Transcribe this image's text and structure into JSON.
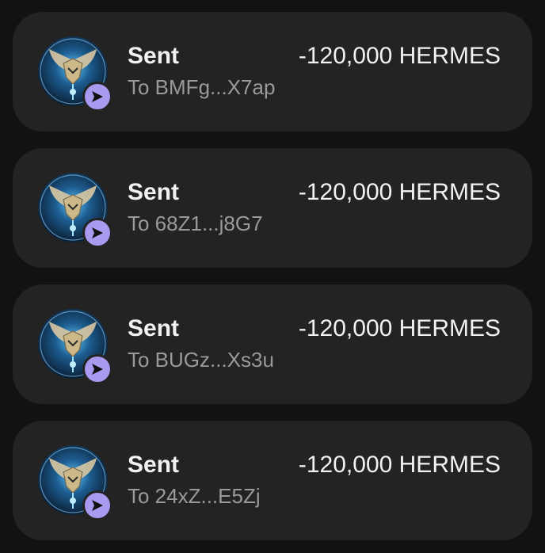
{
  "colors": {
    "background": "#121212",
    "card": "#232323",
    "badge": "#a99af0",
    "title": "#f2f2f2",
    "subtitle": "#9a9a9a"
  },
  "transactions": [
    {
      "title": "Sent",
      "subtitle": "To BMFg...X7ap",
      "amount": "-120,000 HERMES",
      "avatar_icon": "hermes-token-icon",
      "badge_icon": "send-arrow-icon"
    },
    {
      "title": "Sent",
      "subtitle": "To 68Z1...j8G7",
      "amount": "-120,000 HERMES",
      "avatar_icon": "hermes-token-icon",
      "badge_icon": "send-arrow-icon"
    },
    {
      "title": "Sent",
      "subtitle": "To BUGz...Xs3u",
      "amount": "-120,000 HERMES",
      "avatar_icon": "hermes-token-icon",
      "badge_icon": "send-arrow-icon"
    },
    {
      "title": "Sent",
      "subtitle": "To 24xZ...E5Zj",
      "amount": "-120,000 HERMES",
      "avatar_icon": "hermes-token-icon",
      "badge_icon": "send-arrow-icon"
    }
  ]
}
